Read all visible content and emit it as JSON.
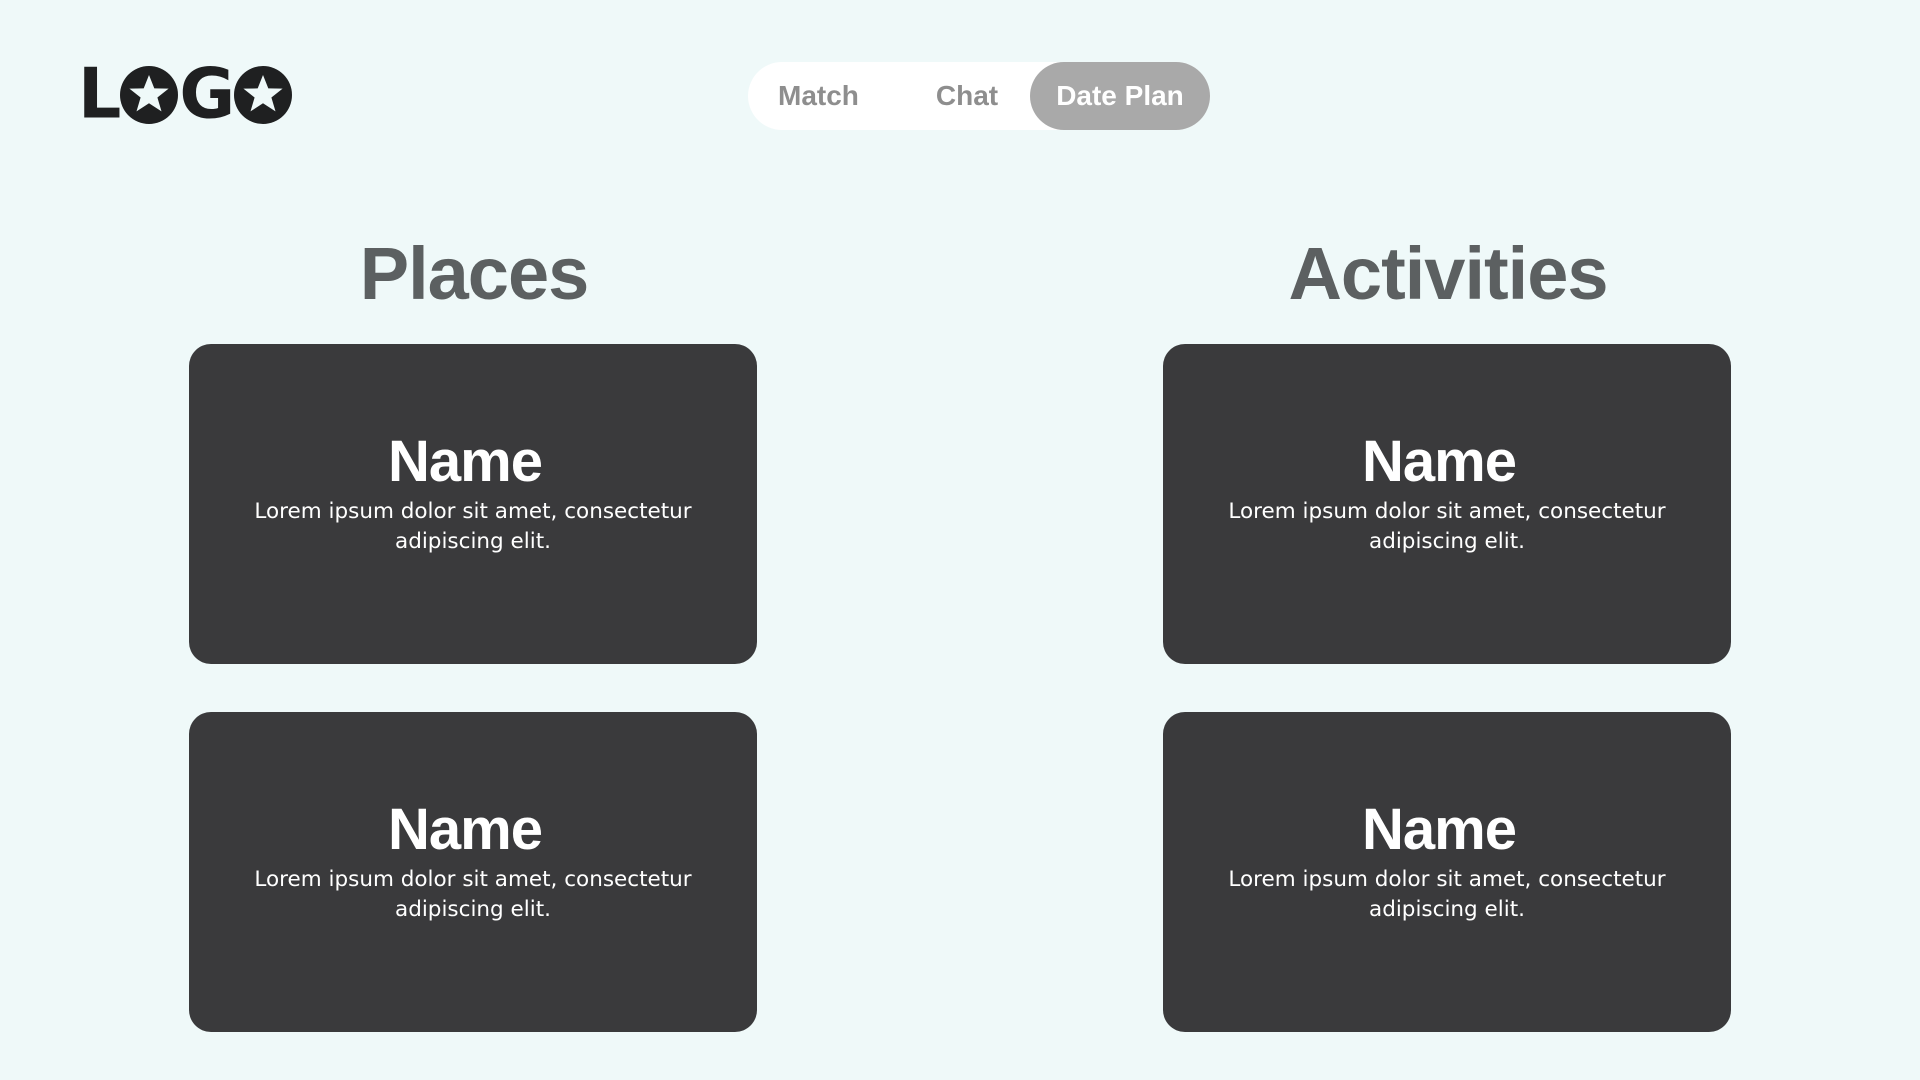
{
  "logo": {
    "letters": [
      "L",
      "G"
    ],
    "icon": "star-circle-icon",
    "color": "#1f2021"
  },
  "nav": {
    "tabs": [
      {
        "label": "Match",
        "active": false
      },
      {
        "label": "Chat",
        "active": false
      },
      {
        "label": "Date Plan",
        "active": true
      }
    ]
  },
  "sections": {
    "places": {
      "title": "Places",
      "cards": [
        {
          "name": "Name",
          "description": "Lorem ipsum dolor sit amet, consectetur adipiscing elit."
        },
        {
          "name": "Name",
          "description": "Lorem ipsum dolor sit amet, consectetur adipiscing elit."
        }
      ]
    },
    "activities": {
      "title": "Activities",
      "cards": [
        {
          "name": "Name",
          "description": "Lorem ipsum dolor sit amet, consectetur adipiscing elit."
        },
        {
          "name": "Name",
          "description": "Lorem ipsum dolor sit amet, consectetur adipiscing elit."
        }
      ]
    }
  },
  "colors": {
    "background": "#eff9f9",
    "card": "#3a3a3c",
    "active_tab": "#a9a9a9",
    "heading": "#5c6061"
  }
}
